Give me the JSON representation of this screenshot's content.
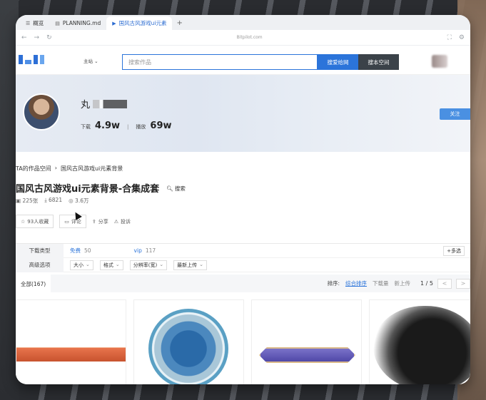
{
  "browser": {
    "tabs": [
      {
        "label": "概览",
        "icon": "grid-icon"
      },
      {
        "label": "PLANNING.md",
        "icon": "file-icon"
      },
      {
        "label": "国风古风游戏ui元素",
        "icon": "play-icon",
        "active": true
      }
    ],
    "address_text": "Bitpilot.com"
  },
  "header": {
    "home_nav": "主站",
    "search_placeholder": "搜索作品",
    "search_site_label": "搜爱给网",
    "search_space_label": "搜本空间"
  },
  "profile": {
    "name": "丸",
    "downloads_label": "下载",
    "downloads_value": "4.9w",
    "plays_label": "播放",
    "plays_value": "69w",
    "follow_label": "关注"
  },
  "breadcrumb": {
    "root": "TA的作品空间",
    "current": "国风古风游戏ui元素背景"
  },
  "collection": {
    "title": "国风古风游戏ui元素背景-合集成套",
    "search_label": "搜索",
    "count": "225张",
    "downloads": "6821",
    "views": "3.6万",
    "favorites_label": "93人收藏",
    "comment_label": "评论",
    "share_label": "分享",
    "report_label": "投诉"
  },
  "filters": {
    "download_type_label": "下载类型",
    "free_label": "免费",
    "free_count": "50",
    "vip_label": "vip",
    "vip_count": "117",
    "multi_label": "+多选",
    "advanced_label": "高级选项",
    "size_label": "大小",
    "format_label": "格式",
    "resolution_label": "分辨率(宽)",
    "latest_label": "最新上传"
  },
  "sortbar": {
    "all_tab": "全部(167)",
    "sort_label": "排序:",
    "sort_options": [
      "综合排序",
      "下载量",
      "新上传"
    ],
    "page": "1",
    "page_total": "5",
    "prev": "<",
    "next": ">"
  }
}
